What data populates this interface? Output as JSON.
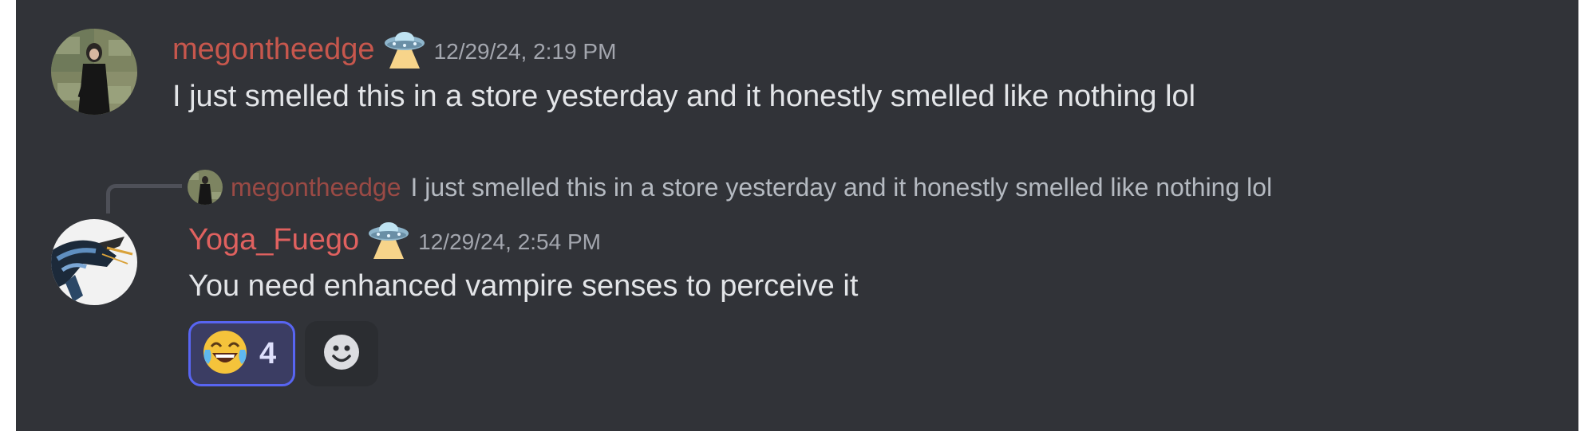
{
  "messages": [
    {
      "username": "megontheedge",
      "timestamp": "12/29/24, 2:19 PM",
      "text": "I just smelled this in a store yesterday and it honestly smelled like nothing lol",
      "avatar": "user-avatar",
      "badge": "ufo-icon"
    },
    {
      "username": "Yoga_Fuego",
      "timestamp": "12/29/24, 2:54 PM",
      "text": "You need enhanced vampire senses to perceive it",
      "avatar": "user-avatar",
      "badge": "ufo-icon",
      "reply": {
        "username": "megontheedge",
        "text": "I just smelled this in a store yesterday and it honestly smelled like nothing lol"
      },
      "reactions": [
        {
          "emoji": "joy-emoji",
          "count": "4",
          "active": true
        }
      ]
    }
  ],
  "colors": {
    "background": "#313338",
    "username_red": "#e0615f",
    "reaction_active_border": "#5865f2",
    "text": "#e3e5e8",
    "muted": "#a3a6ae"
  }
}
